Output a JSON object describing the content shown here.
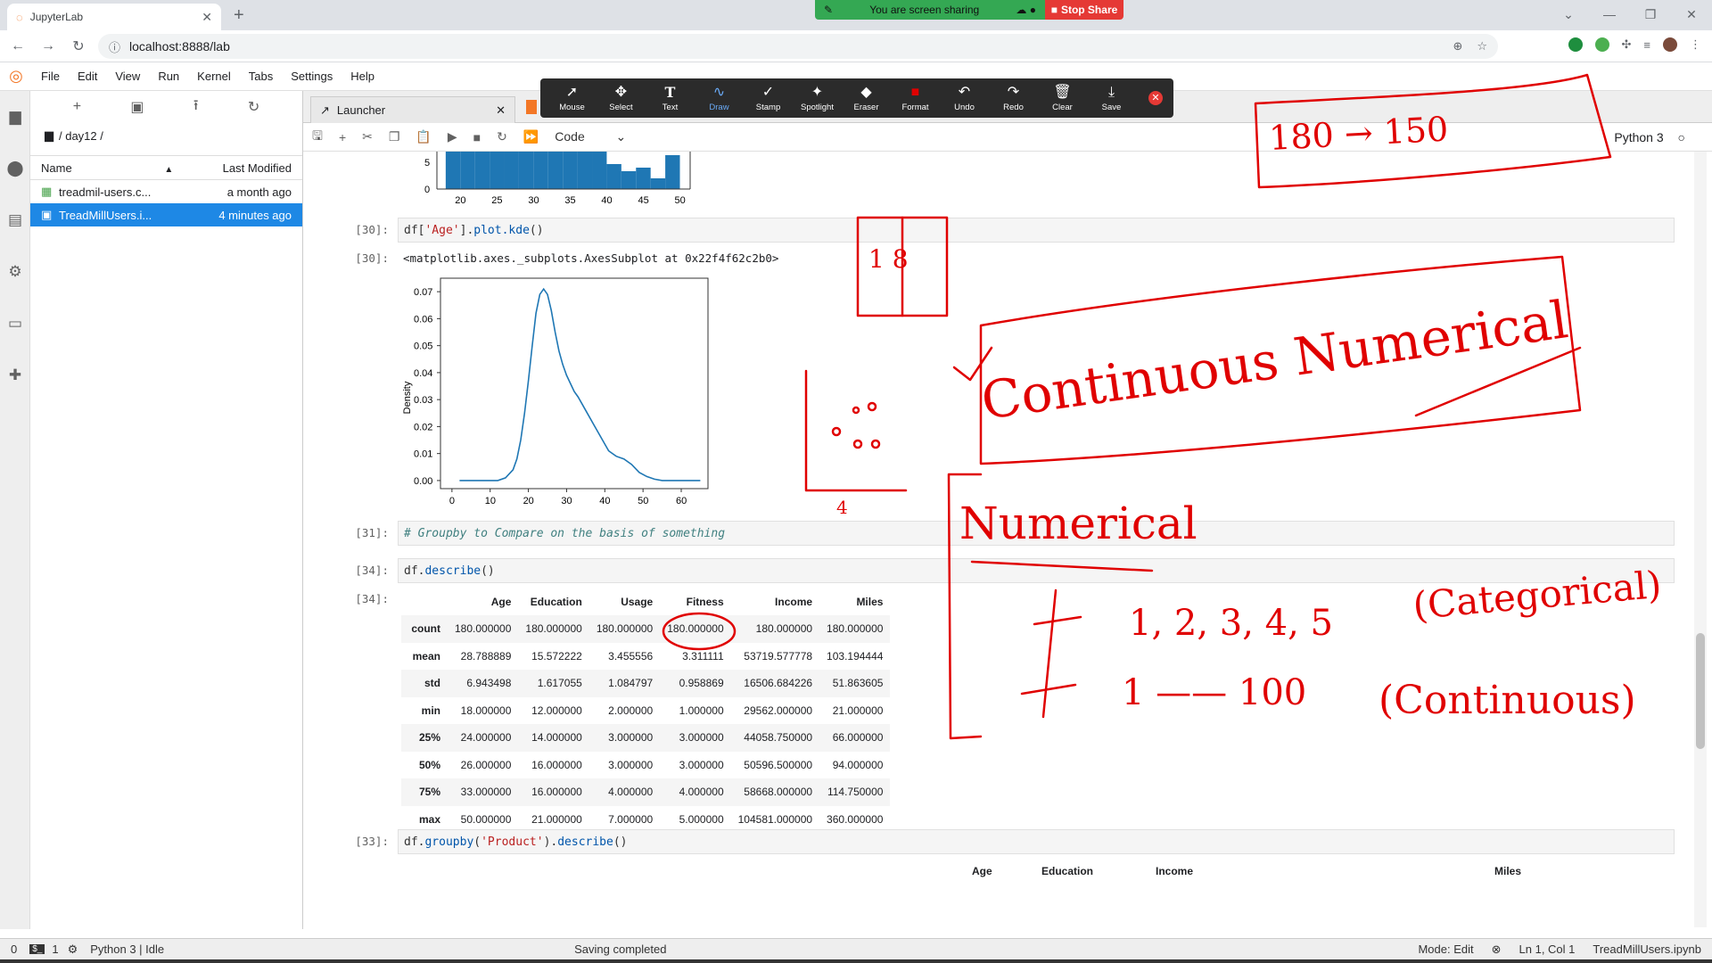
{
  "browser": {
    "tab_title": "JupyterLab",
    "url": "localhost:8888/lab",
    "sharing_text": "You are screen sharing",
    "stop_share": "Stop Share"
  },
  "menubar": [
    "File",
    "Edit",
    "View",
    "Run",
    "Kernel",
    "Tabs",
    "Settings",
    "Help"
  ],
  "filebrowser": {
    "path": "/ day12 /",
    "col_name": "Name",
    "col_modified": "Last Modified",
    "files": [
      {
        "name": "treadmil-users.c...",
        "modified": "a month ago",
        "selected": false
      },
      {
        "name": "TreadMillUsers.i...",
        "modified": "4 minutes ago",
        "selected": true
      }
    ]
  },
  "doc_tab": {
    "title": "Launcher"
  },
  "notebook_toolbar": {
    "cell_type": "Code",
    "kernel": "Python 3"
  },
  "annotate_toolbar": [
    "Mouse",
    "Select",
    "Text",
    "Draw",
    "Stamp",
    "Spotlight",
    "Eraser",
    "Format",
    "Undo",
    "Redo",
    "Clear",
    "Save"
  ],
  "cells": {
    "c30_in_prompt": "[30]:",
    "c30_out_prompt": "[30]:",
    "c30_out_text": "<matplotlib.axes._subplots.AxesSubplot at 0x22f4f62c2b0>",
    "c31_prompt": "[31]:",
    "c31_comment": "# Groupby to Compare on the basis of something",
    "c34_in_prompt": "[34]:",
    "c34_out_prompt": "[34]:",
    "c33_prompt": "[33]:"
  },
  "hist_axis": {
    "y_ticks": [
      "5",
      "0"
    ],
    "x_ticks": [
      "20",
      "25",
      "30",
      "35",
      "40",
      "45",
      "50"
    ]
  },
  "chart_data": {
    "type": "line",
    "ylabel": "Density",
    "xlim": [
      -3,
      67
    ],
    "ylim": [
      -0.003,
      0.075
    ],
    "x_ticks": [
      0,
      10,
      20,
      30,
      40,
      50,
      60
    ],
    "y_ticks": [
      0.0,
      0.01,
      0.02,
      0.03,
      0.04,
      0.05,
      0.06,
      0.07
    ],
    "y_tick_labels": [
      "0.00",
      "0.01",
      "0.02",
      "0.03",
      "0.04",
      "0.05",
      "0.06",
      "0.07"
    ],
    "series": [
      {
        "color": "#1f77b4",
        "x": [
          2,
          8,
          12,
          14,
          16,
          17,
          18,
          19,
          20,
          21,
          22,
          23,
          24,
          25,
          26,
          27,
          28,
          29,
          30,
          31,
          32,
          33,
          35,
          37,
          39,
          41,
          43,
          45,
          47,
          49,
          51,
          53,
          55,
          60,
          65
        ],
        "y": [
          0.0,
          0.0,
          0.0,
          0.001,
          0.004,
          0.008,
          0.015,
          0.025,
          0.037,
          0.05,
          0.062,
          0.069,
          0.071,
          0.069,
          0.063,
          0.055,
          0.048,
          0.043,
          0.039,
          0.036,
          0.033,
          0.031,
          0.026,
          0.021,
          0.016,
          0.011,
          0.009,
          0.008,
          0.006,
          0.003,
          0.0015,
          0.0005,
          0.0,
          0.0,
          0.0
        ]
      }
    ]
  },
  "describe": {
    "columns": [
      "",
      "Age",
      "Education",
      "Usage",
      "Fitness",
      "Income",
      "Miles"
    ],
    "rows": [
      [
        "count",
        "180.000000",
        "180.000000",
        "180.000000",
        "180.000000",
        "180.000000",
        "180.000000"
      ],
      [
        "mean",
        "28.788889",
        "15.572222",
        "3.455556",
        "3.311111",
        "53719.577778",
        "103.194444"
      ],
      [
        "std",
        "6.943498",
        "1.617055",
        "1.084797",
        "0.958869",
        "16506.684226",
        "51.863605"
      ],
      [
        "min",
        "18.000000",
        "12.000000",
        "2.000000",
        "1.000000",
        "29562.000000",
        "21.000000"
      ],
      [
        "25%",
        "24.000000",
        "14.000000",
        "3.000000",
        "3.000000",
        "44058.750000",
        "66.000000"
      ],
      [
        "50%",
        "26.000000",
        "16.000000",
        "3.000000",
        "3.000000",
        "50596.500000",
        "94.000000"
      ],
      [
        "75%",
        "33.000000",
        "16.000000",
        "4.000000",
        "4.000000",
        "58668.000000",
        "114.750000"
      ],
      [
        "max",
        "50.000000",
        "21.000000",
        "7.000000",
        "5.000000",
        "104581.000000",
        "360.000000"
      ]
    ]
  },
  "groupby_headers": [
    "Age",
    "Education",
    "Income",
    "Miles"
  ],
  "statusbar": {
    "left_a": "0",
    "left_b": "1",
    "kernel_status": "Python 3 | Idle",
    "center": "Saving completed",
    "mode": "Mode: Edit",
    "cursor": "Ln 1, Col 1",
    "file": "TreadMillUsers.ipynb"
  },
  "handwriting": {
    "top_right": "180 → 150",
    "box_small": "1 8",
    "continuous": "Continuous Numerical",
    "numerical": "Numerical",
    "row1_left": "1, 2, 3, 4, 5",
    "row1_right": "(Categorical)",
    "row2_left": "1 —— 100",
    "row2_right": "(Continuous)",
    "axis_mark": "4"
  }
}
